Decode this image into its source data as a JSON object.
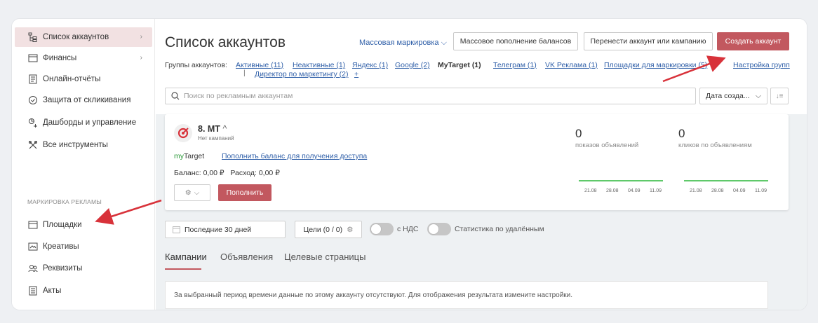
{
  "sidebar": {
    "items": [
      {
        "label": "Список аккаунтов",
        "icon": "account-tree-icon"
      },
      {
        "label": "Финансы",
        "icon": "wallet-icon"
      },
      {
        "label": "Онлайн-отчёты",
        "icon": "report-icon"
      },
      {
        "label": "Защита от скликивания",
        "icon": "shield-icon"
      },
      {
        "label": "Дашборды и управление",
        "icon": "dashboard-icon"
      },
      {
        "label": "Все инструменты",
        "icon": "tools-icon"
      }
    ],
    "section_title": "МАРКИРОВКА РЕКЛАМЫ",
    "section_items": [
      {
        "label": "Площадки",
        "icon": "window-icon"
      },
      {
        "label": "Креативы",
        "icon": "image-icon"
      },
      {
        "label": "Реквизиты",
        "icon": "users-icon"
      },
      {
        "label": "Акты",
        "icon": "document-icon"
      }
    ]
  },
  "header": {
    "title": "Список аккаунтов",
    "mass_marking": "Массовая маркировка",
    "mass_topup": "Массовое пополнение балансов",
    "move_account": "Перенести аккаунт или кампанию",
    "create_account": "Создать аккаунт"
  },
  "groups": {
    "label": "Группы аккаунтов:",
    "items": [
      "Активные (11)",
      "Неактивные (1)",
      "Яндекс (1)",
      "Google (2)",
      "MyTarget (1)",
      "Телеграм (1)",
      "VK Реклама (1)",
      "Площадки для маркировки (5)"
    ],
    "second_line": "Директор по маркетингу (2)",
    "add": "+",
    "settings": "Настройка групп"
  },
  "search": {
    "placeholder": "Поиск по рекламным аккаунтам"
  },
  "sort": {
    "value": "Дата созда..."
  },
  "account": {
    "name": "8. MT",
    "subtitle": "Нет кампаний",
    "platform_my": "my",
    "platform_target": "Target",
    "topup_link": "Пополнить баланс для получения доступа",
    "balance": "Баланс: 0,00 ₽",
    "spend": "Расход: 0,00 ₽",
    "fill_button": "Пополнить",
    "impressions": {
      "value": "0",
      "label": "показов объявлений"
    },
    "clicks": {
      "value": "0",
      "label": "кликов по объявлениям"
    },
    "spark_dates": [
      "21.08",
      "28.08",
      "04.09",
      "11.09"
    ]
  },
  "filters": {
    "period": "Последние 30 дней",
    "goals": "Цели (0 / 0)",
    "vat": "с НДС",
    "deleted_stats": "Статистика по удалённым"
  },
  "tabs": [
    "Кампании",
    "Объявления",
    "Целевые страницы"
  ],
  "notice": "За выбранный период времени данные по этому аккаунту отсутствуют. Для отображения результата измените настройки.",
  "colors": {
    "accent": "#c2585f",
    "link": "#2f5fa8",
    "active_bg": "#f2e1e2",
    "spark": "#5fc96a",
    "arrow": "#d8323a"
  }
}
